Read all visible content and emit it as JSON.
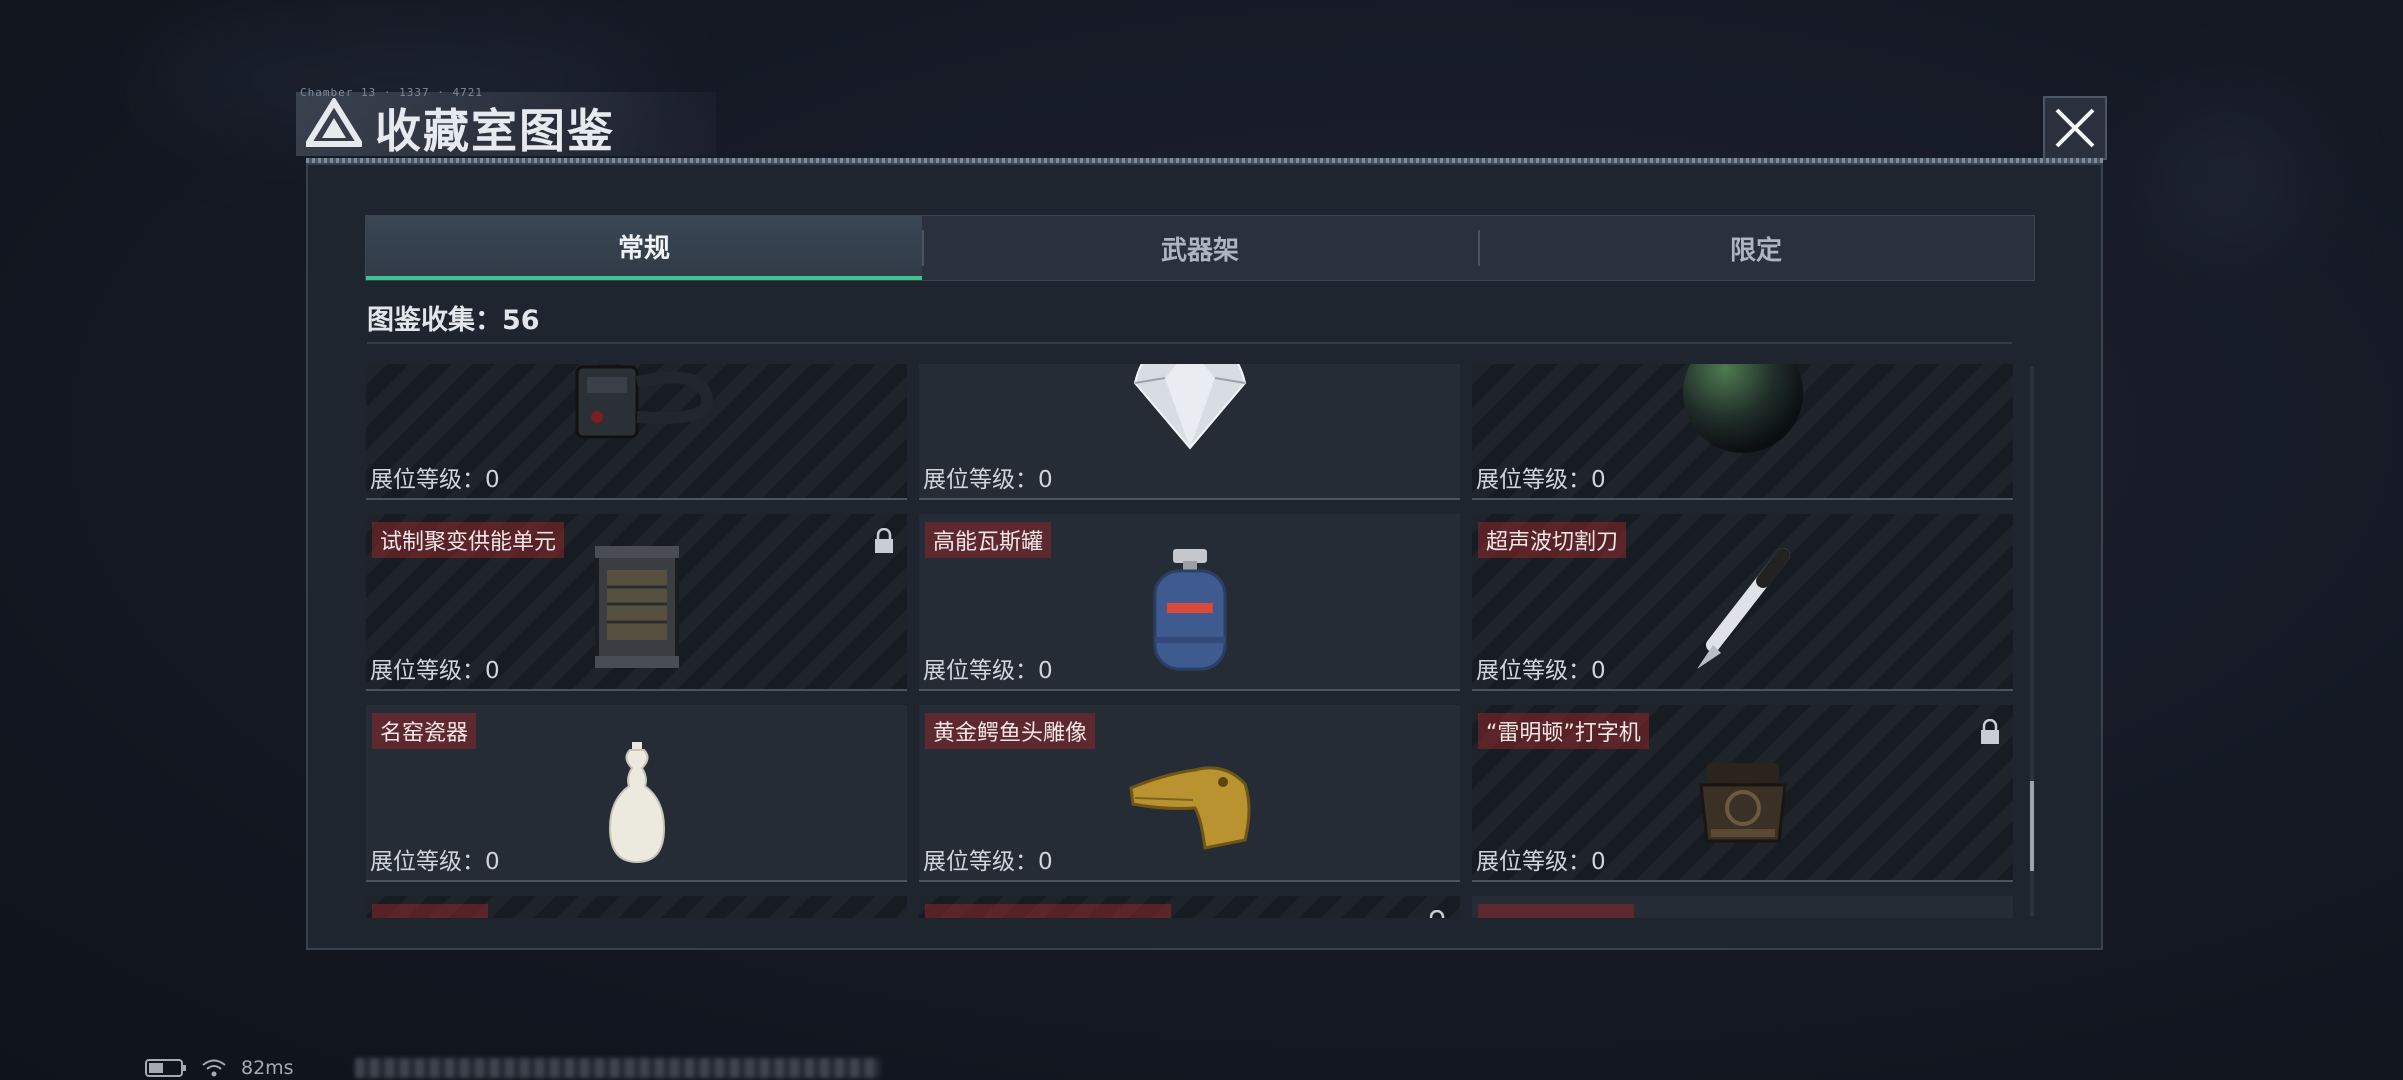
{
  "window": {
    "title": "收藏室图鉴",
    "code_text": "Chamber 13 · 1337 · 4721"
  },
  "tabs": [
    {
      "label": "常规",
      "active": true
    },
    {
      "label": "武器架",
      "active": false
    },
    {
      "label": "限定",
      "active": false
    }
  ],
  "collection": {
    "label": "图鉴收集：",
    "count": "56"
  },
  "level_label": "展位等级：0",
  "cards": [
    {
      "name": "",
      "item": "bracelet-device",
      "locked": true
    },
    {
      "name": "",
      "item": "diamond",
      "locked": false
    },
    {
      "name": "",
      "item": "dark-sphere",
      "locked": true
    },
    {
      "name": "试制聚变供能单元",
      "item": "fusion-power-unit",
      "locked": true
    },
    {
      "name": "高能瓦斯罐",
      "item": "gas-canister",
      "locked": false
    },
    {
      "name": "超声波切割刀",
      "item": "ultrasonic-cutter",
      "locked": false
    },
    {
      "name": "名窑瓷器",
      "item": "porcelain-vase",
      "locked": false
    },
    {
      "name": "黄金鳄鱼头雕像",
      "item": "golden-crocodile-head",
      "locked": false
    },
    {
      "name": "“雷明顿”打字机",
      "item": "typewriter",
      "locked": true
    },
    {
      "name": "",
      "item": "",
      "locked": false
    },
    {
      "name": "",
      "item": "",
      "locked": true
    },
    {
      "name": "",
      "item": "",
      "locked": false
    }
  ],
  "status": {
    "ping": "82ms"
  },
  "colors": {
    "accent": "#3ec58a",
    "name_tag": "#8c2828",
    "panel": "#1f252f"
  }
}
